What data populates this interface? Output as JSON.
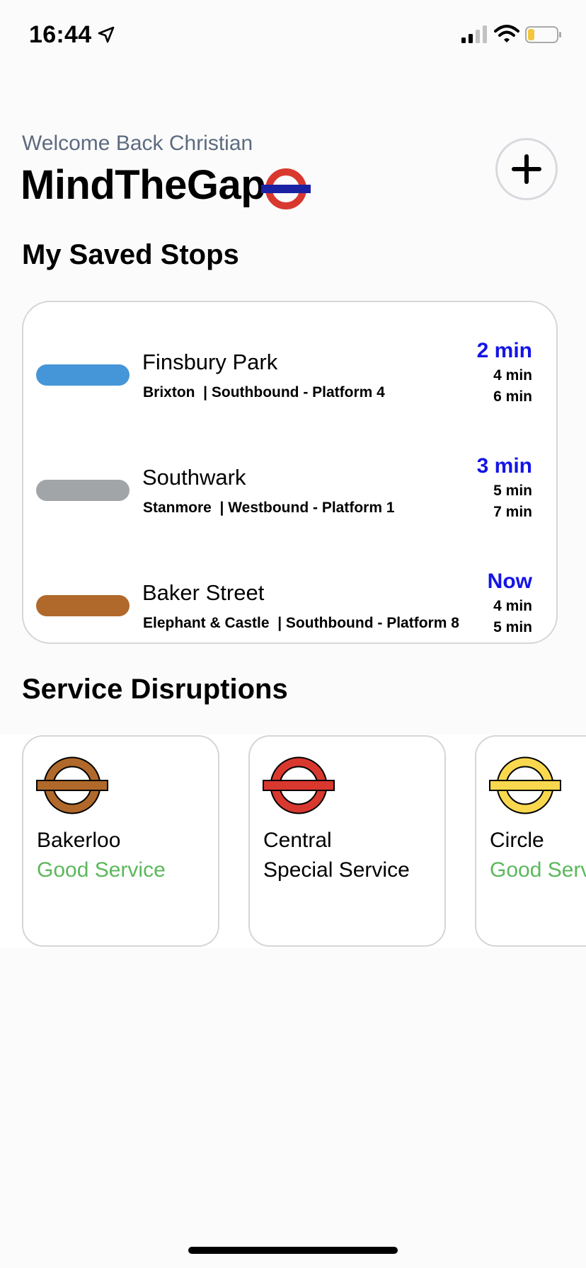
{
  "status_bar": {
    "time": "16:44",
    "icons": [
      "location-arrow-icon",
      "cellular-signal-icon",
      "wifi-icon",
      "battery-icon"
    ]
  },
  "header": {
    "welcome": "Welcome Back Christian",
    "title": "MindTheGap",
    "logo_icon": "underground-roundel-icon",
    "add_icon": "plus-icon"
  },
  "saved_stops": {
    "title": "My Saved Stops",
    "items": [
      {
        "name": "Finsbury Park",
        "detail": "Brixton  | Southbound - Platform 4",
        "line_color": "#4596d8",
        "next": "2 min",
        "following": [
          "4 min",
          "6 min"
        ]
      },
      {
        "name": "Southwark",
        "detail": "Stanmore  | Westbound - Platform 1",
        "line_color": "#a1a5a7",
        "next": "3 min",
        "following": [
          "5 min",
          "7 min"
        ]
      },
      {
        "name": "Baker Street",
        "detail": "Elephant & Castle  | Southbound - Platform 8",
        "line_color": "#b0692a",
        "next": "Now",
        "following": [
          "4 min",
          "5 min"
        ]
      }
    ]
  },
  "disruptions": {
    "title": "Service Disruptions",
    "items": [
      {
        "line": "Bakerloo",
        "status": "Good Service",
        "line_color": "#b0692a",
        "status_color": "#5cb85c"
      },
      {
        "line": "Central",
        "status": "Special Service",
        "line_color": "#d9382f",
        "status_color": "#000000"
      },
      {
        "line": "Circle",
        "status": "Good Service",
        "line_color": "#f9d84e",
        "status_color": "#5cb85c"
      }
    ]
  },
  "colors": {
    "accent_eta": "#1414e6",
    "roundel_red": "#d9382f",
    "roundel_bar": "#1b21a3"
  }
}
